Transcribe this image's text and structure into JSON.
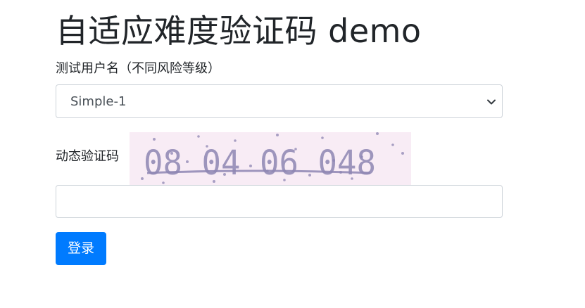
{
  "page": {
    "title": "自适应难度验证码 demo"
  },
  "form": {
    "username_label": "测试用户名（不同风险等级）",
    "username_select": {
      "selected": "Simple-1",
      "icon": "chevron-down-icon"
    },
    "captcha_label": "动态验证码",
    "captcha_text": "08 04 06 048",
    "captcha_input_value": "",
    "captcha_input_placeholder": "",
    "submit_label": "登录"
  },
  "colors": {
    "primary": "#007bff",
    "captcha_background": "#f8ecf5",
    "captcha_ink": "#8e86b3"
  }
}
